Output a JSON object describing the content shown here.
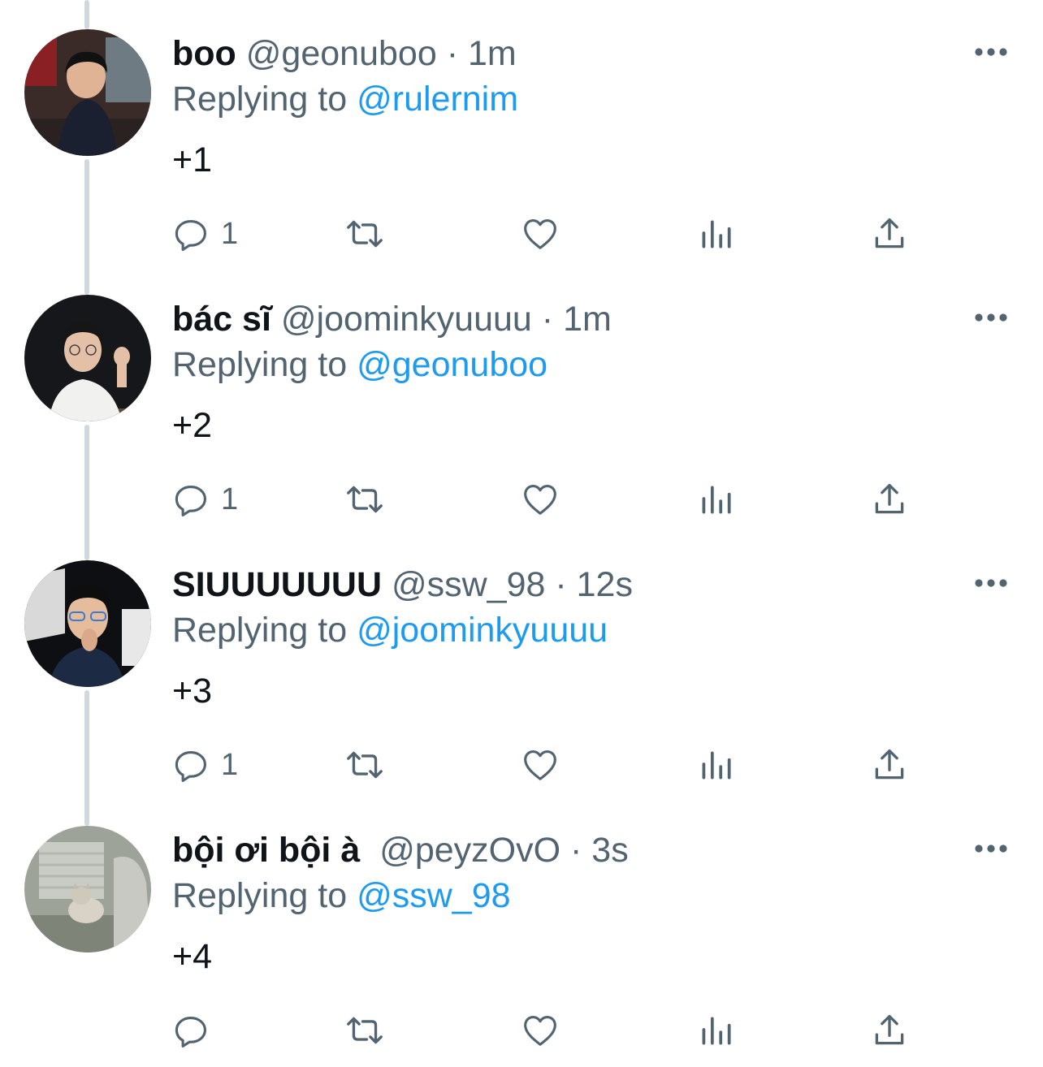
{
  "reply_prefix": "Replying to",
  "theme": {
    "text": "#0f1419",
    "secondary": "#536471",
    "link": "#1d9bf0",
    "thread_line": "#cfd9de"
  },
  "icons": [
    "more-icon",
    "reply-icon",
    "retweet-icon",
    "like-icon",
    "views-icon",
    "share-icon"
  ],
  "tweets": [
    {
      "display_name": "boo",
      "handle": "@geonuboo",
      "separator": "·",
      "time": "1m",
      "replying_to": "@rulernim",
      "text": "+1",
      "reply_count": "1"
    },
    {
      "display_name": "bác sĩ",
      "handle": "@joominkyuuuu",
      "separator": "·",
      "time": "1m",
      "replying_to": "@geonuboo",
      "text": "+2",
      "reply_count": "1"
    },
    {
      "display_name": "SIUUUUUUU",
      "handle": "@ssw_98",
      "separator": "·",
      "time": "12s",
      "replying_to": "@joominkyuuuu",
      "text": "+3",
      "reply_count": "1"
    },
    {
      "display_name": "bội ơi bội à",
      "handle": "@peyzOvO",
      "separator": "·",
      "time": "3s",
      "replying_to": "@ssw_98",
      "text": "+4",
      "reply_count": ""
    }
  ]
}
